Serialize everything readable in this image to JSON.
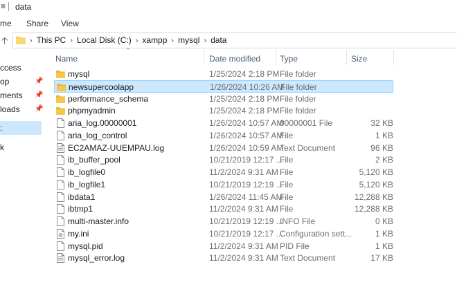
{
  "window": {
    "title": "data"
  },
  "ribbon": {
    "tabs": [
      "me",
      "Share",
      "View"
    ]
  },
  "address": {
    "crumbs": [
      "This PC",
      "Local Disk (C:)",
      "xampp",
      "mysql",
      "data"
    ]
  },
  "nav": {
    "items": [
      {
        "label": "ccess",
        "pinned": false
      },
      {
        "label": "op",
        "pinned": true
      },
      {
        "label": "ments",
        "pinned": true
      },
      {
        "label": "loads",
        "pinned": true
      },
      {
        "label": ":",
        "pinned": false,
        "selected": true
      },
      {
        "label": "k",
        "pinned": false
      }
    ]
  },
  "columns": {
    "name": "Name",
    "date": "Date modified",
    "type": "Type",
    "size": "Size"
  },
  "files": [
    {
      "name": "mysql",
      "date": "1/25/2024 2:18 PM",
      "type": "File folder",
      "size": "",
      "icon": "folder-icon"
    },
    {
      "name": "newsupercoolapp",
      "date": "1/26/2024 10:26 AM",
      "type": "File folder",
      "size": "",
      "icon": "folder-icon",
      "selected": true
    },
    {
      "name": "performance_schema",
      "date": "1/25/2024 2:18 PM",
      "type": "File folder",
      "size": "",
      "icon": "folder-icon"
    },
    {
      "name": "phpmyadmin",
      "date": "1/25/2024 2:18 PM",
      "type": "File folder",
      "size": "",
      "icon": "folder-icon"
    },
    {
      "name": "aria_log.00000001",
      "date": "1/26/2024 10:57 AM",
      "type": "00000001 File",
      "size": "32 KB",
      "icon": "file-icon"
    },
    {
      "name": "aria_log_control",
      "date": "1/26/2024 10:57 AM",
      "type": "File",
      "size": "1 KB",
      "icon": "file-icon"
    },
    {
      "name": "EC2AMAZ-UUEMPAU.log",
      "date": "1/26/2024 10:59 AM",
      "type": "Text Document",
      "size": "96 KB",
      "icon": "text-document-icon"
    },
    {
      "name": "ib_buffer_pool",
      "date": "10/21/2019 12:17 ...",
      "type": "File",
      "size": "2 KB",
      "icon": "file-icon"
    },
    {
      "name": "ib_logfile0",
      "date": "11/2/2024 9:31 AM",
      "type": "File",
      "size": "5,120 KB",
      "icon": "file-icon"
    },
    {
      "name": "ib_logfile1",
      "date": "10/21/2019 12:19 ...",
      "type": "File",
      "size": "5,120 KB",
      "icon": "file-icon"
    },
    {
      "name": "ibdata1",
      "date": "1/26/2024 11:45 AM",
      "type": "File",
      "size": "12,288 KB",
      "icon": "file-icon"
    },
    {
      "name": "ibtmp1",
      "date": "11/2/2024 9:31 AM",
      "type": "File",
      "size": "12,288 KB",
      "icon": "file-icon"
    },
    {
      "name": "multi-master.info",
      "date": "10/21/2019 12:19 ...",
      "type": "INFO File",
      "size": "0 KB",
      "icon": "file-icon"
    },
    {
      "name": "my.ini",
      "date": "10/21/2019 12:17 ...",
      "type": "Configuration sett...",
      "size": "1 KB",
      "icon": "config-file-icon"
    },
    {
      "name": "mysql.pid",
      "date": "11/2/2024 9:31 AM",
      "type": "PID File",
      "size": "1 KB",
      "icon": "file-icon"
    },
    {
      "name": "mysql_error.log",
      "date": "11/2/2024 9:31 AM",
      "type": "Text Document",
      "size": "17 KB",
      "icon": "text-document-icon"
    }
  ],
  "colors": {
    "folder": "#f3c94a",
    "selection": "#cce8ff",
    "selection_border": "#99d1ff",
    "header_text": "#4c607a"
  }
}
